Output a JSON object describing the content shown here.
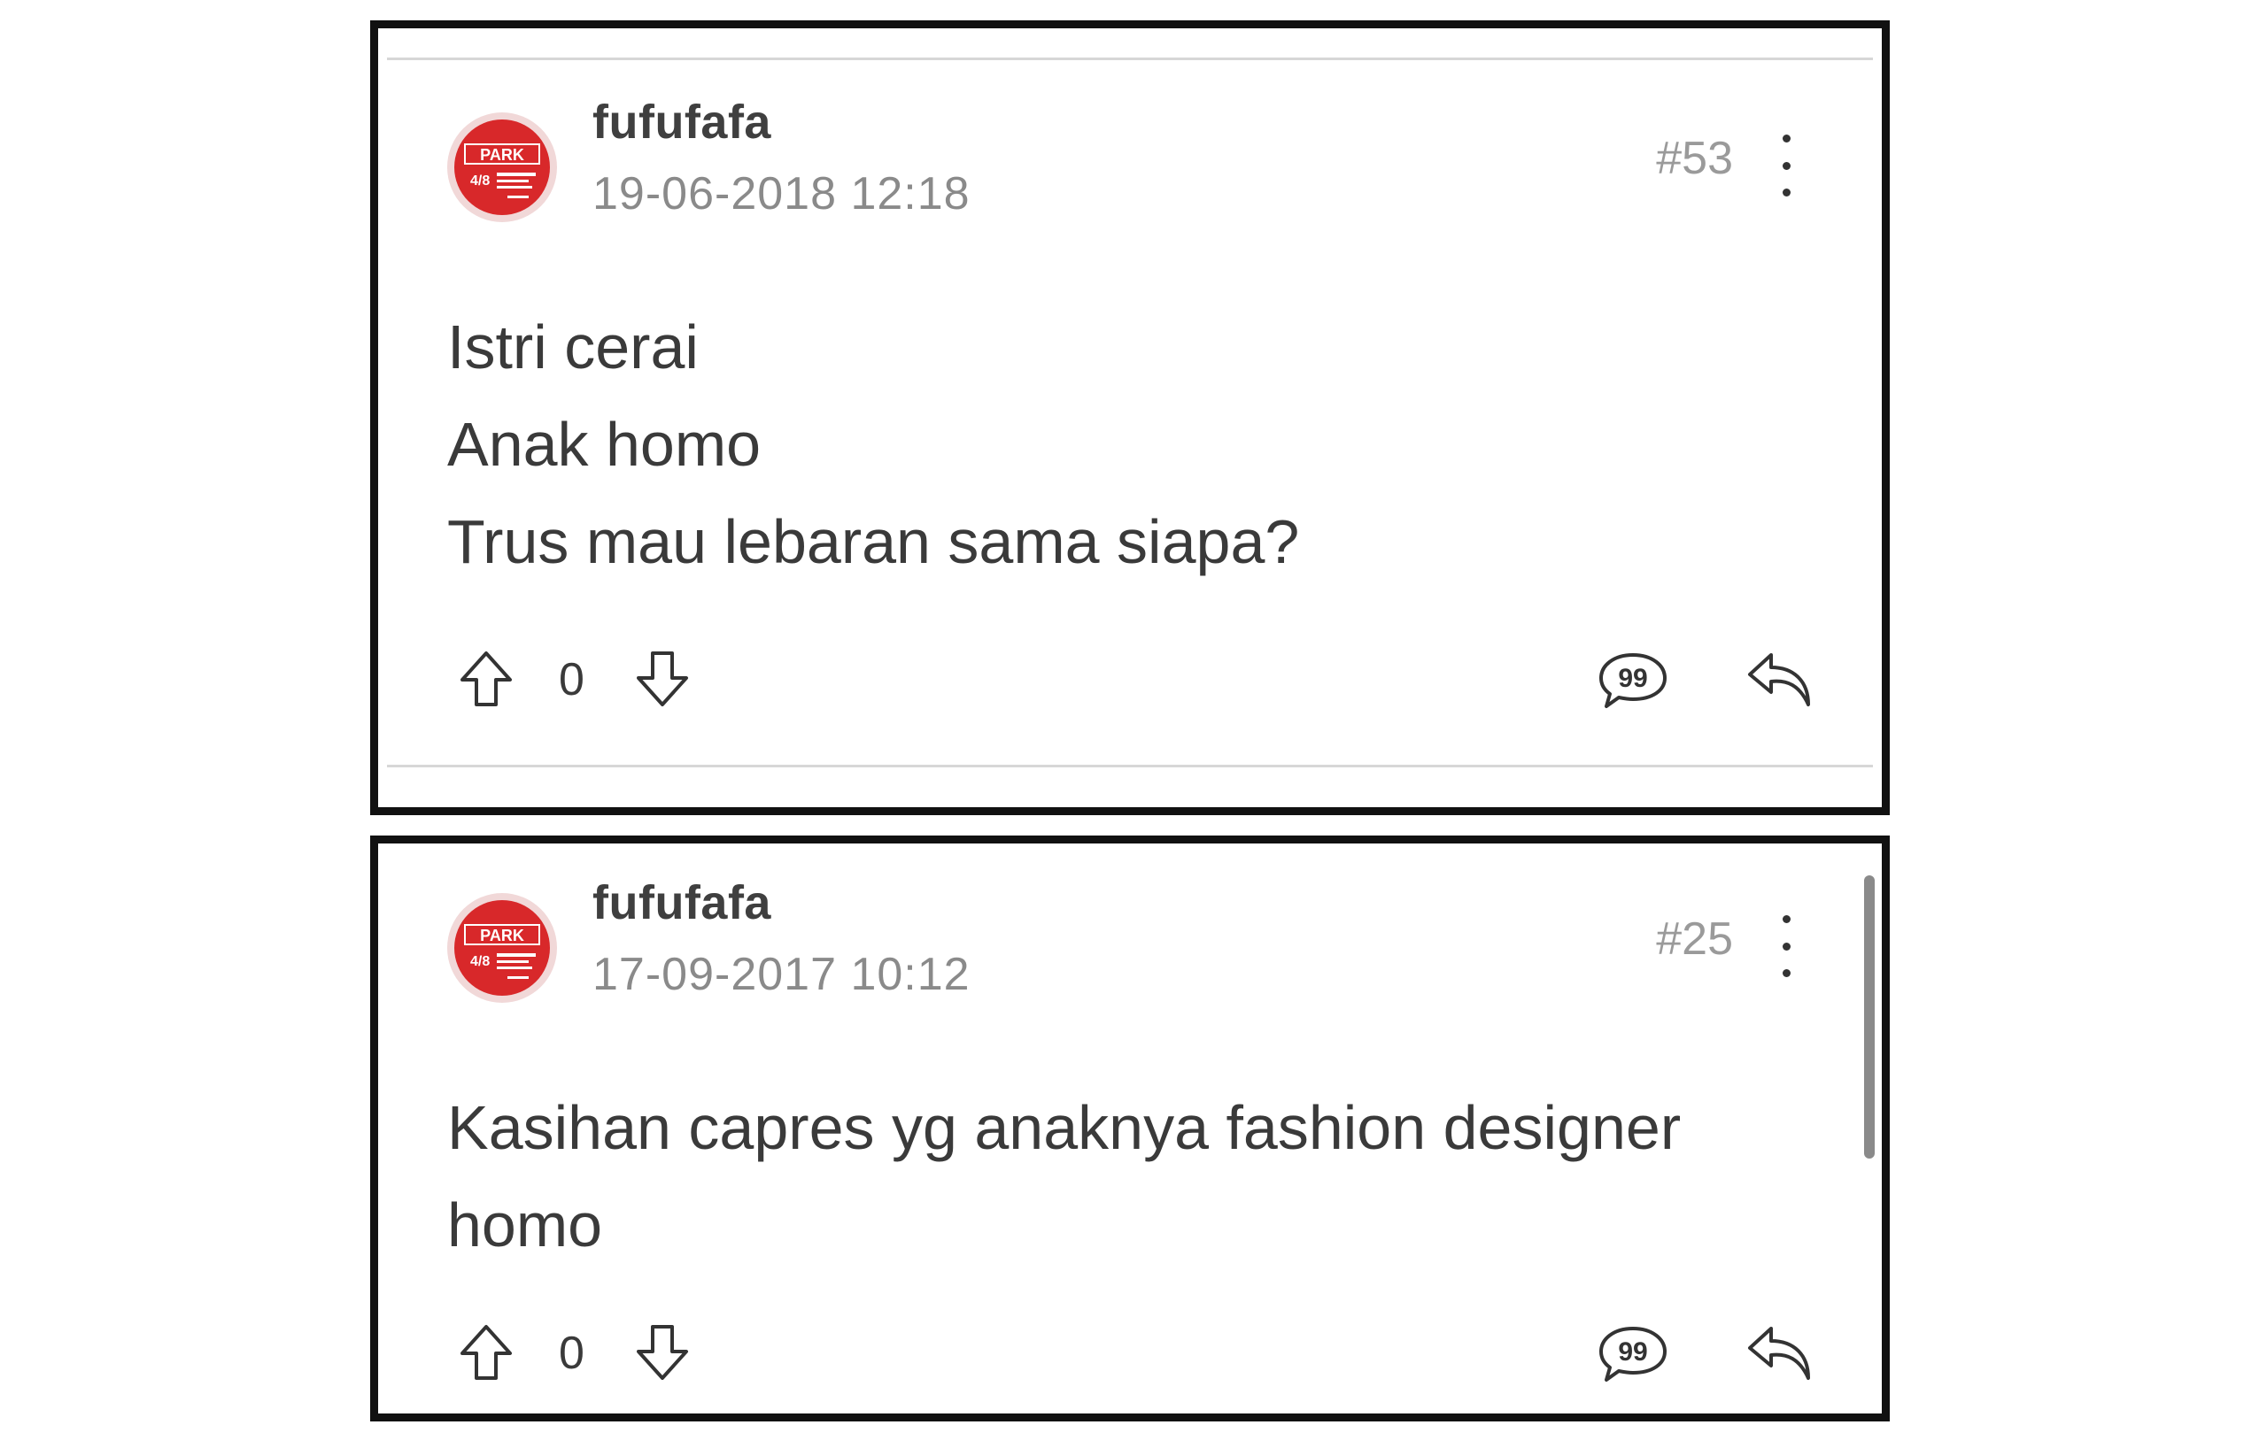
{
  "posts": [
    {
      "username": "fufufafa",
      "timestamp": "19-06-2018 12:18",
      "post_number": "#53",
      "content_lines": [
        "Istri cerai",
        "Anak homo",
        "Trus mau lebaran sama siapa?"
      ],
      "vote_count": "0",
      "avatar_text": "PARK"
    },
    {
      "username": "fufufafa",
      "timestamp": "17-09-2017 10:12",
      "post_number": "#25",
      "content_lines": [
        "Kasihan capres yg anaknya fashion designer",
        "homo"
      ],
      "vote_count": "0",
      "avatar_text": "PARK"
    }
  ],
  "icons": {
    "upvote": "arrow-up-icon",
    "downvote": "arrow-down-icon",
    "quote": "quote-icon",
    "reply": "reply-icon",
    "more": "more-vertical-icon"
  },
  "colors": {
    "avatar_red": "#d8282a",
    "border": "#111111",
    "text": "#3a3a3a",
    "muted": "#8a8a8a"
  }
}
